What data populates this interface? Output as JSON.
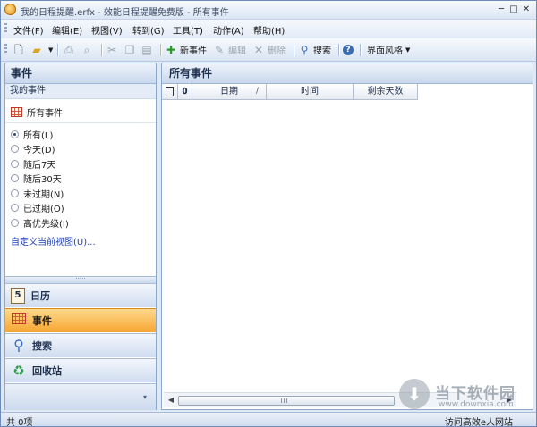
{
  "window": {
    "title": "我的日程提醒.erfx - 效能日程提醒免费版 - 所有事件",
    "minimize": "─",
    "maximize": "□",
    "close": "✕"
  },
  "menu": [
    {
      "label": "文件(F)"
    },
    {
      "label": "编辑(E)"
    },
    {
      "label": "视图(V)"
    },
    {
      "label": "转到(G)"
    },
    {
      "label": "工具(T)"
    },
    {
      "label": "动作(A)"
    },
    {
      "label": "帮助(H)"
    }
  ],
  "toolbar": {
    "new_event": "新事件",
    "edit": "编辑",
    "delete": "删除",
    "search": "搜索",
    "help_glyph": "?",
    "theme": "界面风格"
  },
  "left_pane": {
    "header": "事件",
    "section": "我的事件",
    "all_events": "所有事件",
    "filters": [
      {
        "label": "所有(L)",
        "selected": true
      },
      {
        "label": "今天(D)",
        "selected": false
      },
      {
        "label": "随后7天",
        "selected": false
      },
      {
        "label": "随后30天",
        "selected": false
      },
      {
        "label": "未过期(N)",
        "selected": false
      },
      {
        "label": "已过期(O)",
        "selected": false
      },
      {
        "label": "高优先级(I)",
        "selected": false
      }
    ],
    "customize": "自定义当前视图(U)...",
    "nav": [
      {
        "label": "日历",
        "icon": "calendar-icon",
        "active": false
      },
      {
        "label": "事件",
        "icon": "events-grid-icon",
        "active": true
      },
      {
        "label": "搜索",
        "icon": "magnifier-icon",
        "active": false
      },
      {
        "label": "回收站",
        "icon": "recycle-icon",
        "active": false
      }
    ]
  },
  "right_pane": {
    "header": "所有事件",
    "columns": [
      "日期",
      "时间",
      "剩余天数"
    ],
    "sort_indicator": "/"
  },
  "watermark": {
    "text": "当下软件园",
    "url": "www.downxia.com"
  },
  "status": {
    "count": "共 0项",
    "link": "访问高效e人网站"
  },
  "colors": {
    "accent_active": "#f6a531",
    "header_blue": "#c9d8ed",
    "link_blue": "#1f3fb8"
  }
}
